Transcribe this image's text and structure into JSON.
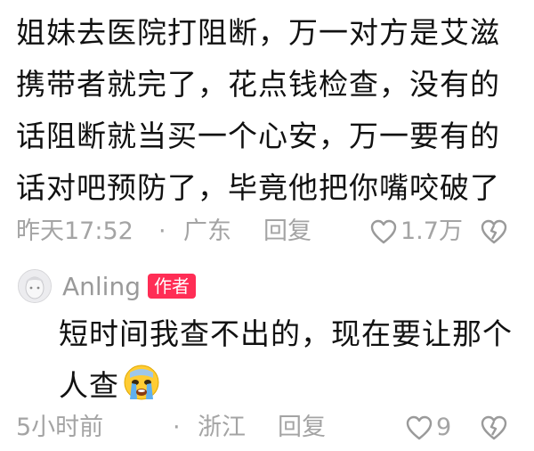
{
  "comment": {
    "lines": [
      "姐妹去医院打阻断，万一对方是艾滋",
      "携带者就完了，花点钱检查，没有的",
      "话阻断就当买一个心安，万一要有的",
      "话对吧预防了，毕竟他把你嘴咬破了"
    ],
    "time": "昨天17:52",
    "separator": "·",
    "location": "广东",
    "reply_label": "回复",
    "like_count": "1.7万"
  },
  "reply": {
    "username": "Anling",
    "author_badge": "作者",
    "lines": [
      "短时间我查不出的，现在要让那个",
      "人查"
    ],
    "emoji": "crying-face-emoji",
    "time": "5小时前",
    "separator": "·",
    "location": "浙江",
    "reply_label": "回复",
    "like_count": "9"
  },
  "colors": {
    "text": "#111111",
    "meta": "#a4a4a4",
    "badge": "#ff2d55"
  }
}
